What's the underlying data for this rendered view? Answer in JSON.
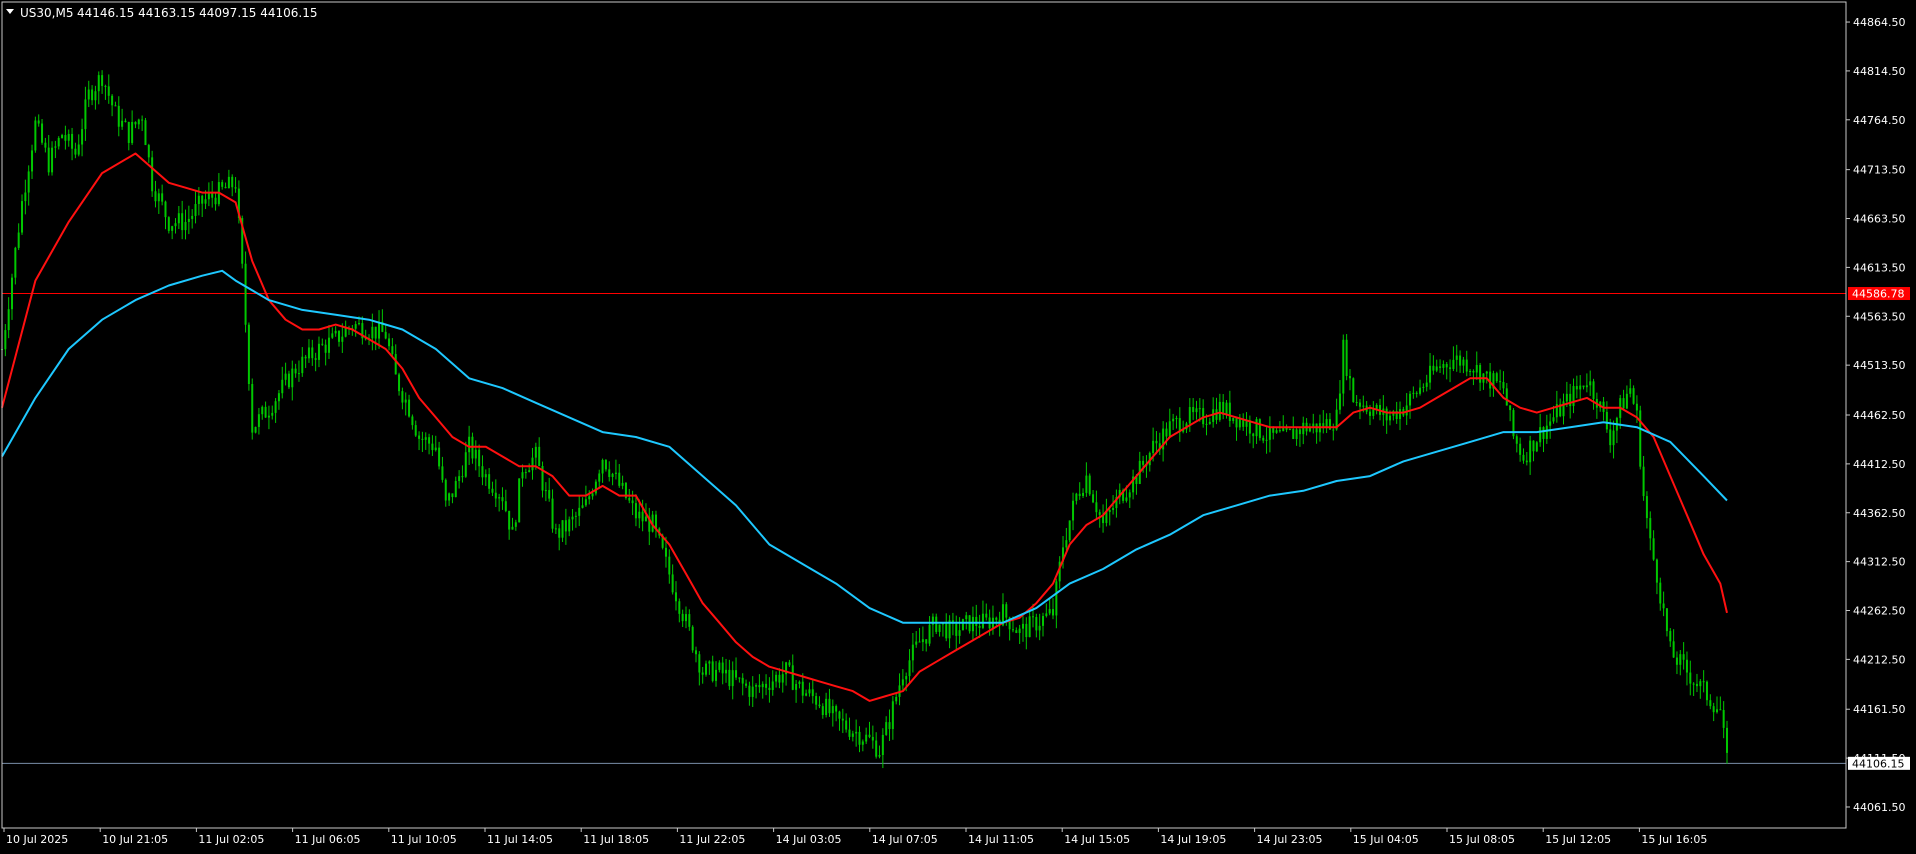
{
  "header": {
    "symbol_label": "US30,M5",
    "ohlc_values": "44146.15 44163.15 44097.15 44106.15"
  },
  "colors": {
    "background": "#000000",
    "frame": "#c8c8c8",
    "candle": "#00c800",
    "ma_fast": "#ff1010",
    "ma_slow": "#1ec8ff",
    "h_line": "#ff0000",
    "bid_line": "#7a8ea8",
    "bid_tag_bg": "#ffffff",
    "bid_tag_text": "#000000",
    "hline_tag_text": "#ffffff"
  },
  "icons": {
    "dropdown": "triangle-down-icon"
  },
  "chart_data": {
    "type": "candlestick",
    "symbol": "US30",
    "timeframe": "M5",
    "ylim": [
      44040,
      44885
    ],
    "y_ticks": [
      "44864.50",
      "44814.50",
      "44764.50",
      "44713.50",
      "44663.50",
      "44613.50",
      "44563.50",
      "44513.50",
      "44462.50",
      "44412.50",
      "44362.50",
      "44312.50",
      "44262.50",
      "44212.50",
      "44161.50",
      "44111.50",
      "44061.50"
    ],
    "x_tick_labels": [
      "10 Jul 2025",
      "10 Jul 21:05",
      "11 Jul 02:05",
      "11 Jul 06:05",
      "11 Jul 10:05",
      "11 Jul 14:05",
      "11 Jul 18:05",
      "11 Jul 22:05",
      "14 Jul 03:05",
      "14 Jul 07:05",
      "14 Jul 11:05",
      "14 Jul 15:05",
      "14 Jul 19:05",
      "14 Jul 23:05",
      "15 Jul 04:05",
      "15 Jul 08:05",
      "15 Jul 12:05",
      "15 Jul 16:05"
    ],
    "horizontal_line": {
      "value": 44586.78,
      "label": "44586.78"
    },
    "last_price": {
      "value": 44106.15,
      "label": "44106.15"
    },
    "price_path": [
      [
        0,
        44530
      ],
      [
        6,
        44680
      ],
      [
        10,
        44760
      ],
      [
        14,
        44720
      ],
      [
        18,
        44750
      ],
      [
        22,
        44730
      ],
      [
        26,
        44790
      ],
      [
        30,
        44810
      ],
      [
        34,
        44770
      ],
      [
        38,
        44750
      ],
      [
        42,
        44770
      ],
      [
        45,
        44700
      ],
      [
        50,
        44660
      ],
      [
        55,
        44660
      ],
      [
        60,
        44680
      ],
      [
        65,
        44690
      ],
      [
        70,
        44700
      ],
      [
        72,
        44610
      ],
      [
        75,
        44450
      ],
      [
        80,
        44470
      ],
      [
        88,
        44510
      ],
      [
        95,
        44530
      ],
      [
        100,
        44540
      ],
      [
        105,
        44555
      ],
      [
        110,
        44550
      ],
      [
        115,
        44545
      ],
      [
        118,
        44500
      ],
      [
        122,
        44470
      ],
      [
        125,
        44440
      ],
      [
        130,
        44430
      ],
      [
        133,
        44370
      ],
      [
        136,
        44390
      ],
      [
        140,
        44430
      ],
      [
        145,
        44400
      ],
      [
        150,
        44380
      ],
      [
        153,
        44340
      ],
      [
        156,
        44410
      ],
      [
        160,
        44420
      ],
      [
        163,
        44380
      ],
      [
        166,
        44340
      ],
      [
        170,
        44350
      ],
      [
        175,
        44370
      ],
      [
        180,
        44420
      ],
      [
        185,
        44390
      ],
      [
        190,
        44360
      ],
      [
        195,
        44350
      ],
      [
        200,
        44300
      ],
      [
        205,
        44250
      ],
      [
        210,
        44200
      ],
      [
        215,
        44200
      ],
      [
        220,
        44190
      ],
      [
        225,
        44180
      ],
      [
        230,
        44190
      ],
      [
        235,
        44200
      ],
      [
        240,
        44180
      ],
      [
        245,
        44170
      ],
      [
        250,
        44150
      ],
      [
        255,
        44140
      ],
      [
        260,
        44130
      ],
      [
        263,
        44120
      ],
      [
        266,
        44150
      ],
      [
        270,
        44200
      ],
      [
        275,
        44230
      ],
      [
        280,
        44250
      ],
      [
        285,
        44240
      ],
      [
        290,
        44250
      ],
      [
        295,
        44250
      ],
      [
        300,
        44260
      ],
      [
        305,
        44240
      ],
      [
        310,
        44250
      ],
      [
        315,
        44260
      ],
      [
        318,
        44330
      ],
      [
        322,
        44380
      ],
      [
        325,
        44400
      ],
      [
        330,
        44350
      ],
      [
        335,
        44380
      ],
      [
        340,
        44400
      ],
      [
        345,
        44430
      ],
      [
        350,
        44450
      ],
      [
        355,
        44460
      ],
      [
        360,
        44460
      ],
      [
        365,
        44470
      ],
      [
        370,
        44460
      ],
      [
        375,
        44450
      ],
      [
        380,
        44440
      ],
      [
        385,
        44440
      ],
      [
        390,
        44450
      ],
      [
        395,
        44450
      ],
      [
        400,
        44460
      ],
      [
        402,
        44530
      ],
      [
        405,
        44480
      ],
      [
        410,
        44470
      ],
      [
        415,
        44460
      ],
      [
        420,
        44470
      ],
      [
        425,
        44490
      ],
      [
        430,
        44510
      ],
      [
        435,
        44520
      ],
      [
        440,
        44515
      ],
      [
        445,
        44500
      ],
      [
        450,
        44490
      ],
      [
        453,
        44440
      ],
      [
        456,
        44420
      ],
      [
        460,
        44440
      ],
      [
        465,
        44460
      ],
      [
        470,
        44480
      ],
      [
        475,
        44500
      ],
      [
        478,
        44480
      ],
      [
        482,
        44440
      ],
      [
        485,
        44470
      ],
      [
        488,
        44490
      ],
      [
        490,
        44460
      ],
      [
        492,
        44380
      ],
      [
        494,
        44330
      ],
      [
        496,
        44300
      ],
      [
        500,
        44220
      ],
      [
        505,
        44200
      ],
      [
        510,
        44180
      ],
      [
        515,
        44160
      ],
      [
        517,
        44106.15
      ]
    ],
    "series": [
      {
        "x": [
          0,
          10,
          20,
          30,
          40,
          50,
          60,
          65,
          70,
          75,
          80,
          85,
          90,
          95,
          100,
          105,
          110,
          115,
          120,
          125,
          130,
          135,
          140,
          145,
          150,
          155,
          160,
          165,
          170,
          175,
          180,
          185,
          190,
          195,
          200,
          205,
          210,
          215,
          220,
          225,
          230,
          235,
          240,
          245,
          250,
          255,
          260,
          265,
          270,
          275,
          280,
          285,
          290,
          295,
          300,
          305,
          310,
          315,
          320,
          325,
          330,
          335,
          340,
          345,
          350,
          355,
          360,
          365,
          370,
          375,
          380,
          385,
          390,
          395,
          400,
          405,
          410,
          415,
          420,
          425,
          430,
          435,
          440,
          445,
          450,
          455,
          460,
          465,
          470,
          475,
          480,
          485,
          490,
          495,
          500,
          505,
          510,
          515,
          517
        ],
        "y": [
          44470,
          44600,
          44660,
          44710,
          44730,
          44700,
          44690,
          44690,
          44680,
          44620,
          44580,
          44560,
          44550,
          44550,
          44555,
          44550,
          44540,
          44530,
          44510,
          44480,
          44460,
          44440,
          44430,
          44430,
          44420,
          44410,
          44410,
          44400,
          44380,
          44380,
          44390,
          44380,
          44380,
          44350,
          44330,
          44300,
          44270,
          44250,
          44230,
          44215,
          44205,
          44200,
          44195,
          44190,
          44185,
          44180,
          44170,
          44175,
          44180,
          44200,
          44210,
          44220,
          44230,
          44240,
          44250,
          44255,
          44270,
          44290,
          44330,
          44350,
          44360,
          44380,
          44400,
          44420,
          44440,
          44450,
          44460,
          44465,
          44460,
          44455,
          44450,
          44450,
          44450,
          44450,
          44450,
          44465,
          44470,
          44465,
          44465,
          44470,
          44480,
          44490,
          44500,
          44500,
          44480,
          44470,
          44465,
          44470,
          44475,
          44480,
          44470,
          44470,
          44460,
          44440,
          44400,
          44360,
          44320,
          44290,
          44260
        ]
      },
      {
        "x": [
          0,
          10,
          20,
          30,
          40,
          50,
          60,
          66,
          70,
          80,
          90,
          100,
          110,
          120,
          130,
          140,
          150,
          160,
          170,
          180,
          190,
          200,
          210,
          220,
          230,
          240,
          250,
          260,
          270,
          280,
          290,
          300,
          310,
          320,
          330,
          340,
          350,
          360,
          370,
          380,
          390,
          400,
          410,
          420,
          430,
          440,
          450,
          460,
          470,
          480,
          490,
          500,
          510,
          517
        ],
        "y": [
          44420,
          44480,
          44530,
          44560,
          44580,
          44595,
          44605,
          44610,
          44600,
          44580,
          44570,
          44565,
          44560,
          44550,
          44530,
          44500,
          44490,
          44475,
          44460,
          44445,
          44440,
          44430,
          44400,
          44370,
          44330,
          44310,
          44290,
          44265,
          44250,
          44250,
          44250,
          44250,
          44265,
          44290,
          44305,
          44325,
          44340,
          44360,
          44370,
          44380,
          44385,
          44395,
          44400,
          44415,
          44425,
          44435,
          44445,
          44445,
          44450,
          44455,
          44450,
          44435,
          44400,
          44375
        ]
      }
    ]
  }
}
